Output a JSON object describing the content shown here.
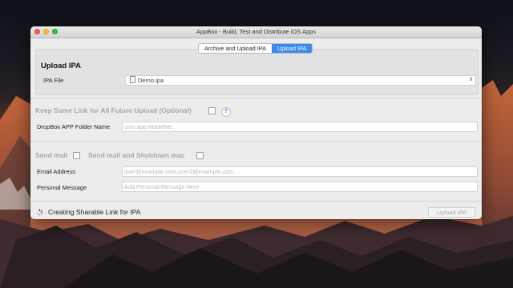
{
  "window": {
    "title": "AppBox - Build, Test and Distribute iOS Apps"
  },
  "tabs": [
    {
      "label": "Archive and Upload IPA",
      "active": false
    },
    {
      "label": "Upload IPA",
      "active": true
    }
  ],
  "upload": {
    "title": "Upload IPA",
    "ipa_file_label": "IPA File",
    "ipa_file_value": "Demo.ipa"
  },
  "link": {
    "keep_same_label": "Keep Same Link for All Future Upload (Optional)",
    "help_glyph": "?",
    "dropbox_label": "DropBox APP Folder Name",
    "dropbox_placeholder": "com.app.ModelMe"
  },
  "mail": {
    "send_mail_label": "Send mail",
    "send_mail_shutdown_label": "Send mail and Shutdown mac",
    "email_label": "Email Address",
    "email_placeholder": "user@example.com,user2@example.com,...",
    "message_label": "Personal Message",
    "message_placeholder": "Add Personal Message Here"
  },
  "status": {
    "text": "Creating Sharable Link for IPA",
    "button_label": "Upload IPA"
  },
  "colors": {
    "accent": "#3a8bf0",
    "close": "#fc5f57",
    "minimize": "#fdbc2e",
    "zoom": "#28c840"
  },
  "icons": [
    "close-button",
    "minimize-button",
    "zoom-button",
    "document-icon",
    "chevron-updown-icon",
    "help-icon",
    "spinner-icon"
  ]
}
